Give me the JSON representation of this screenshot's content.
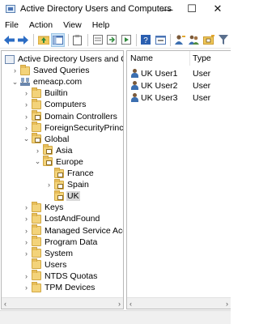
{
  "window": {
    "title": "Active Directory Users and Computers",
    "minimize": "—",
    "maximize": "☐",
    "close": "✕"
  },
  "menu": [
    "File",
    "Action",
    "View",
    "Help"
  ],
  "toolbar": [
    "back-arrow-icon",
    "forward-arrow-icon",
    "up-folder-icon",
    "show-tree-icon",
    "clipboard-icon",
    "properties-icon",
    "export-icon",
    "refresh-icon",
    "help-icon",
    "console-icon",
    "add-user-icon",
    "add-group-icon",
    "add-ou-icon",
    "filter-icon"
  ],
  "tree": [
    {
      "label": "Active Directory Users and Com",
      "level": 0,
      "chevron": "",
      "icon": "root"
    },
    {
      "label": "Saved Queries",
      "level": 1,
      "chevron": "›",
      "icon": "folder"
    },
    {
      "label": "emeacp.com",
      "level": 1,
      "chevron": "⌄",
      "icon": "domain"
    },
    {
      "label": "Builtin",
      "level": 2,
      "chevron": "›",
      "icon": "folder"
    },
    {
      "label": "Computers",
      "level": 2,
      "chevron": "›",
      "icon": "folder"
    },
    {
      "label": "Domain Controllers",
      "level": 2,
      "chevron": "›",
      "icon": "ou"
    },
    {
      "label": "ForeignSecurityPrincipals",
      "level": 2,
      "chevron": "›",
      "icon": "folder"
    },
    {
      "label": "Global",
      "level": 2,
      "chevron": "⌄",
      "icon": "ou"
    },
    {
      "label": "Asia",
      "level": 3,
      "chevron": "›",
      "icon": "ou"
    },
    {
      "label": "Europe",
      "level": 3,
      "chevron": "⌄",
      "icon": "ou"
    },
    {
      "label": "France",
      "level": 4,
      "chevron": "",
      "icon": "ou"
    },
    {
      "label": "Spain",
      "level": 4,
      "chevron": "›",
      "icon": "ou"
    },
    {
      "label": "UK",
      "level": 4,
      "chevron": "",
      "icon": "ou",
      "selected": true
    },
    {
      "label": "Keys",
      "level": 2,
      "chevron": "›",
      "icon": "folder"
    },
    {
      "label": "LostAndFound",
      "level": 2,
      "chevron": "›",
      "icon": "folder"
    },
    {
      "label": "Managed Service Accour",
      "level": 2,
      "chevron": "›",
      "icon": "folder"
    },
    {
      "label": "Program Data",
      "level": 2,
      "chevron": "›",
      "icon": "folder"
    },
    {
      "label": "System",
      "level": 2,
      "chevron": "›",
      "icon": "folder"
    },
    {
      "label": "Users",
      "level": 2,
      "chevron": "",
      "icon": "folder"
    },
    {
      "label": "NTDS Quotas",
      "level": 2,
      "chevron": "›",
      "icon": "folder"
    },
    {
      "label": "TPM Devices",
      "level": 2,
      "chevron": "›",
      "icon": "folder"
    }
  ],
  "list": {
    "columns": [
      "Name",
      "Type"
    ],
    "rows": [
      {
        "name": "UK User1",
        "type": "User"
      },
      {
        "name": "UK User2",
        "type": "User"
      },
      {
        "name": "UK User3",
        "type": "User"
      }
    ]
  },
  "scroll": {
    "left": "‹",
    "right": "›"
  }
}
